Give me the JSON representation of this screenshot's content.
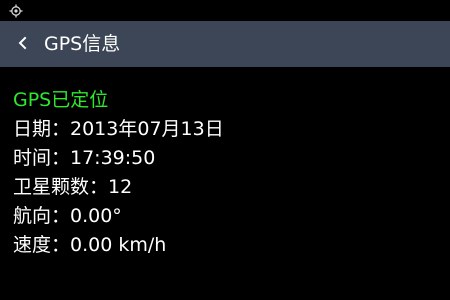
{
  "status_bar": {
    "icon": "gps-locate-icon"
  },
  "header": {
    "back_icon": "chevron-left-icon",
    "title": "GPS信息"
  },
  "gps": {
    "fix_status": "GPS已定位",
    "date": "日期：2013年07月13日",
    "time": "时间：17:39:50",
    "satellites": "卫星颗数：12",
    "heading": "航向：0.00°",
    "speed": "速度：0.00 km/h"
  },
  "colors": {
    "background": "#000000",
    "app_bar": "#3d4656",
    "fix_status_green": "#2ee82e",
    "text": "#ffffff"
  }
}
